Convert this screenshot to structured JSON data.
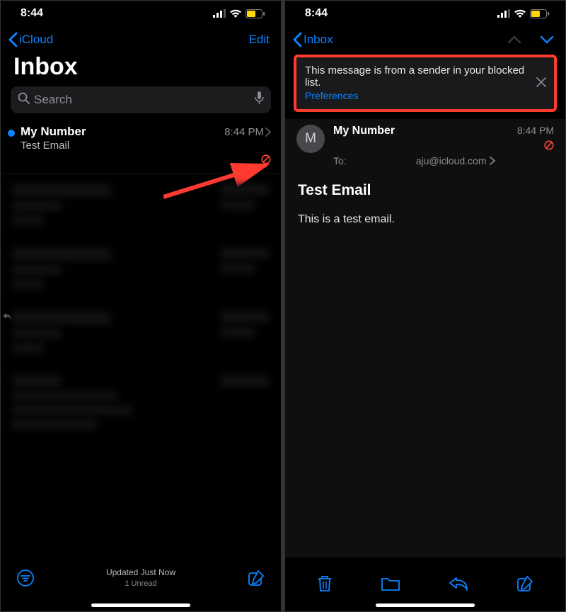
{
  "left": {
    "status": {
      "time": "8:44"
    },
    "nav": {
      "back_label": "iCloud",
      "edit_label": "Edit"
    },
    "title": "Inbox",
    "search_placeholder": "Search",
    "message": {
      "sender": "My Number",
      "time": "8:44 PM",
      "subject": "Test Email"
    },
    "bottom": {
      "status": "Updated Just Now",
      "sub": "1 Unread"
    }
  },
  "right": {
    "status": {
      "time": "8:44"
    },
    "nav": {
      "back_label": "Inbox"
    },
    "banner": {
      "text": "This message is from a sender in your blocked list.",
      "pref_label": "Preferences"
    },
    "header": {
      "avatar_initial": "M",
      "sender": "My Number",
      "time": "8:44 PM",
      "to_prefix": "To:",
      "to_suffix": "aju@icloud.com"
    },
    "body": {
      "subject": "Test Email",
      "text": "This is a test email."
    }
  }
}
